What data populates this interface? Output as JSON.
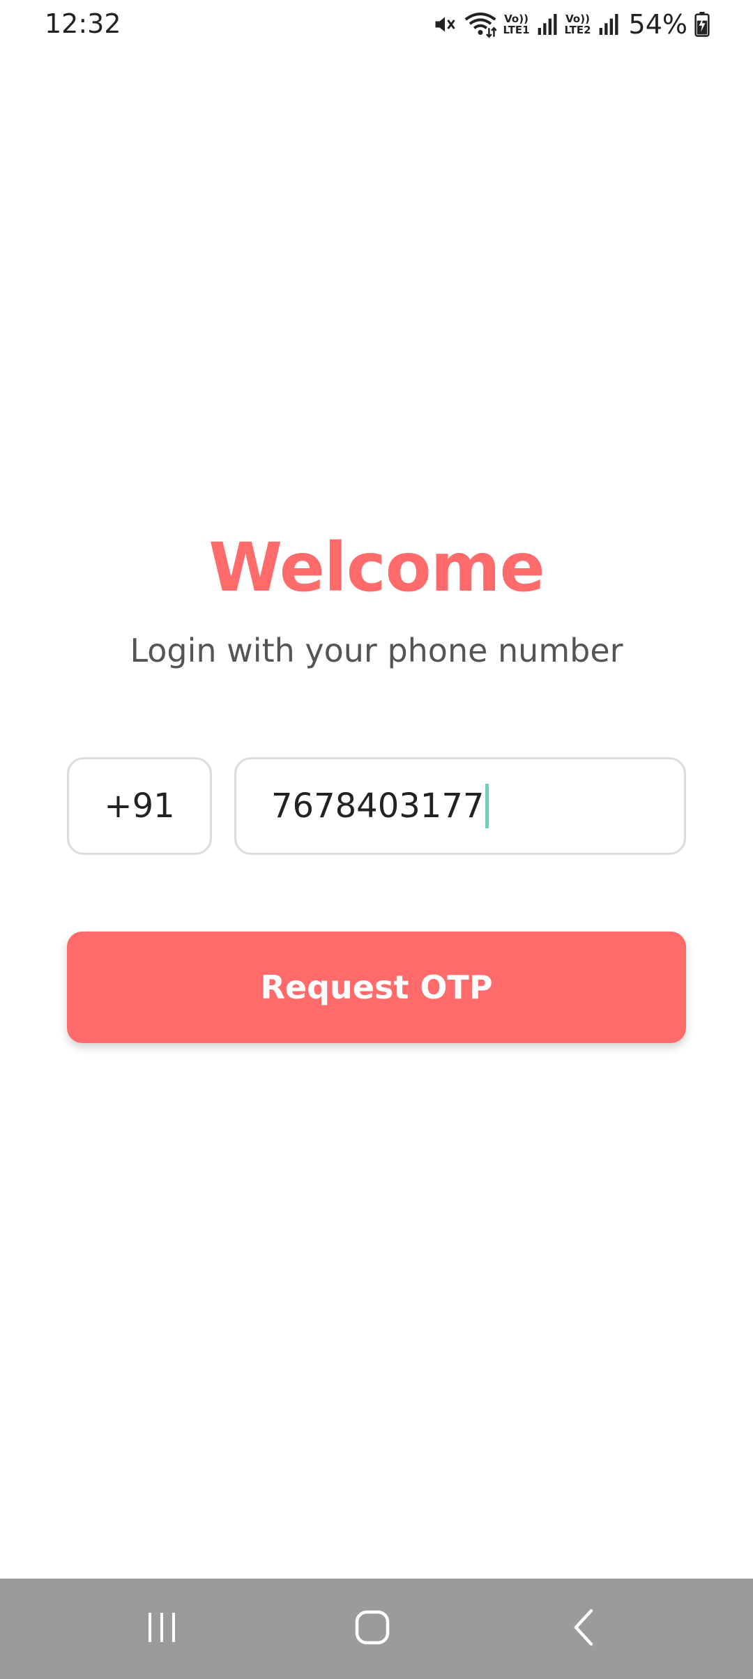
{
  "status_bar": {
    "time": "12:32",
    "sim1_label_top": "Vo))",
    "sim1_label_bottom": "LTE1",
    "sim2_label_top": "Vo))",
    "sim2_label_bottom": "LTE2",
    "battery": "54%",
    "icons": [
      "mute-icon",
      "wifi-icon",
      "signal-icon",
      "battery-charging-icon"
    ]
  },
  "login": {
    "title": "Welcome",
    "subtitle": "Login with your phone number",
    "country_code": "+91",
    "phone_value": "7678403177",
    "button_label": "Request OTP"
  },
  "nav_bar": {
    "icons": [
      "recent-apps-icon",
      "home-icon",
      "back-icon"
    ]
  },
  "colors": {
    "accent": "#ff6b6b",
    "subtitle": "#555555",
    "field_border": "#dcdcdc",
    "cursor": "#7ec8c2",
    "nav_bar": "#9b9b9b"
  }
}
